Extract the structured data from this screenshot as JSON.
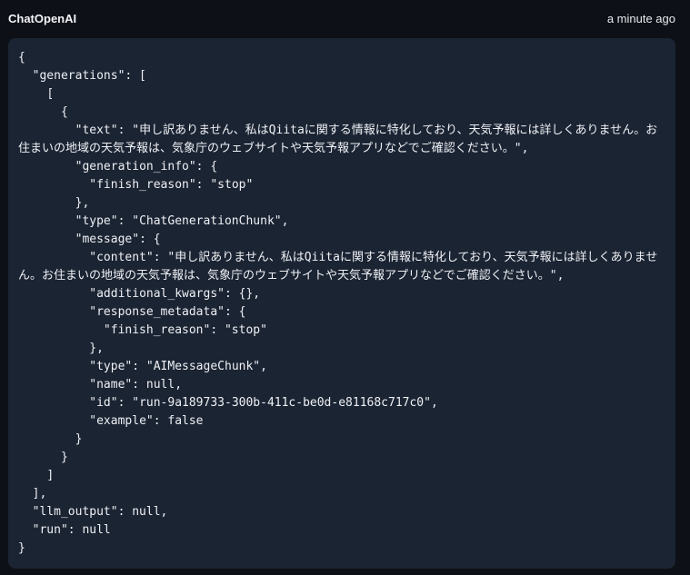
{
  "header": {
    "run_name": "ChatOpenAI",
    "timestamp": "a minute ago"
  },
  "output": {
    "generations": [
      [
        {
          "text": "申し訳ありません、私はQiitaに関する情報に特化しており、天気予報には詳しくありません。お住まいの地域の天気予報は、気象庁のウェブサイトや天気予報アプリなどでご確認ください。",
          "generation_info": {
            "finish_reason": "stop"
          },
          "type": "ChatGenerationChunk",
          "message": {
            "content": "申し訳ありません、私はQiitaに関する情報に特化しており、天気予報には詳しくありません。お住まいの地域の天気予報は、気象庁のウェブサイトや天気予報アプリなどでご確認ください。",
            "additional_kwargs": {},
            "response_metadata": {
              "finish_reason": "stop"
            },
            "type": "AIMessageChunk",
            "name": null,
            "id": "run-9a189733-300b-411c-be0d-e81168c717c0",
            "example": false
          }
        }
      ]
    ],
    "llm_output": null,
    "run": null
  }
}
